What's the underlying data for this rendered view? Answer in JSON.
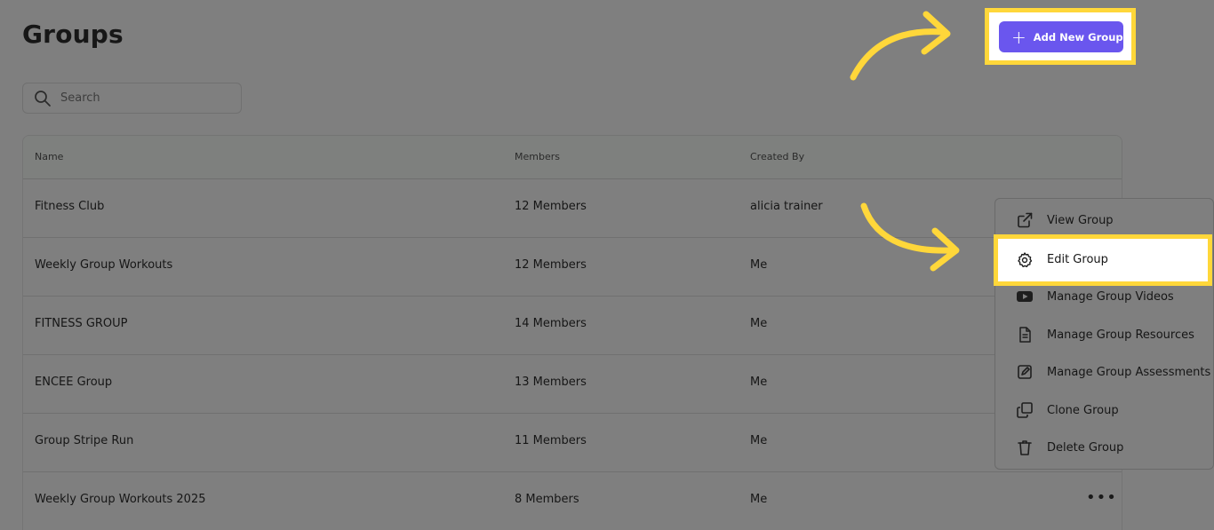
{
  "page": {
    "title": "Groups"
  },
  "search": {
    "placeholder": "Search",
    "icon": "search-icon"
  },
  "toolbar": {
    "add_label": "Add New Group",
    "add_icon": "plus-icon",
    "add_color": "#6a56ee"
  },
  "table": {
    "headers": {
      "name": "Name",
      "members": "Members",
      "created_by": "Created By"
    },
    "rows": [
      {
        "name": "Fitness Club",
        "members": "12 Members",
        "created_by": "alicia trainer"
      },
      {
        "name": "Weekly Group Workouts",
        "members": "12 Members",
        "created_by": "Me"
      },
      {
        "name": "FITNESS GROUP",
        "members": "14 Members",
        "created_by": "Me"
      },
      {
        "name": "ENCEE Group",
        "members": "13 Members",
        "created_by": "Me"
      },
      {
        "name": "Group Stripe Run",
        "members": "11 Members",
        "created_by": "Me"
      },
      {
        "name": "Weekly Group Workouts 2025",
        "members": "8 Members",
        "created_by": "Me"
      }
    ],
    "more_label": "•••"
  },
  "menu": {
    "items": [
      {
        "label": "View Group",
        "icon": "external-link-icon"
      },
      {
        "label": "Edit Group",
        "icon": "gear-icon"
      },
      {
        "label": "Manage Group Videos",
        "icon": "youtube-icon"
      },
      {
        "label": "Manage Group Resources",
        "icon": "document-icon"
      },
      {
        "label": "Manage Group Assessments",
        "icon": "edit-square-icon"
      },
      {
        "label": "Clone Group",
        "icon": "copy-icon"
      },
      {
        "label": "Delete Group",
        "icon": "trash-icon"
      }
    ]
  },
  "colors": {
    "highlight": "#ffd73a",
    "overlay": "#7f7f7f"
  }
}
